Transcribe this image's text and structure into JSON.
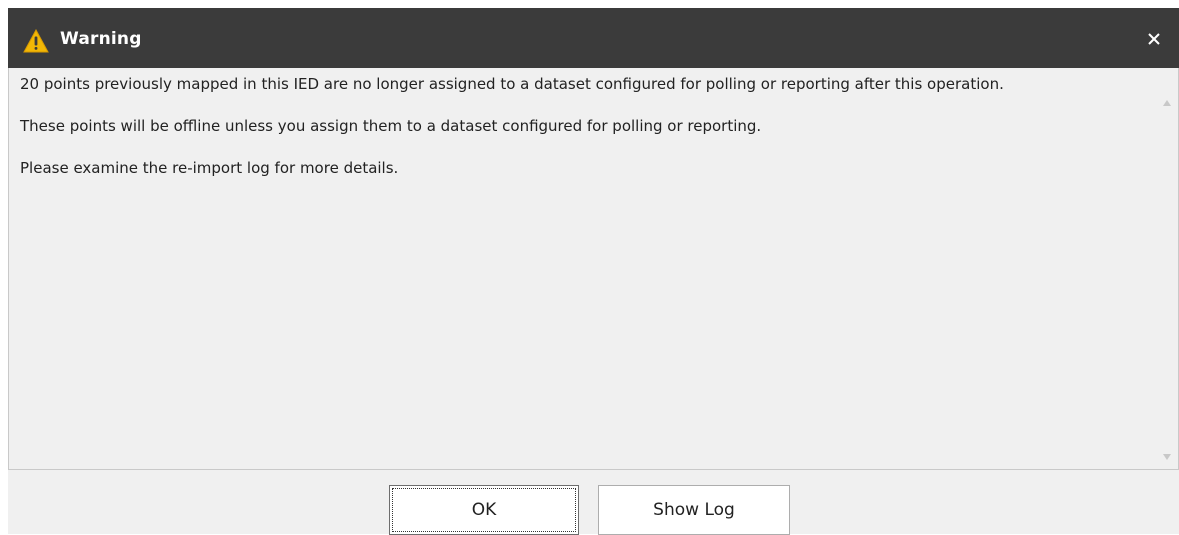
{
  "window": {
    "title": "Warning",
    "title_icon": "warning-triangle-icon",
    "close_icon": "close-icon"
  },
  "message": {
    "paragraphs": [
      "20 points previously mapped in this IED are no longer assigned to a dataset configured for polling or reporting after this operation.",
      "These points will be offline unless you assign them to a dataset configured for polling or reporting.",
      "Please examine the re-import log for more details."
    ]
  },
  "buttons": {
    "ok_label": "OK",
    "show_log_label": "Show Log"
  },
  "colors": {
    "titlebar": "#3b3b3b",
    "warning_icon": "#f2b705",
    "body_background": "#f0f0f0"
  }
}
